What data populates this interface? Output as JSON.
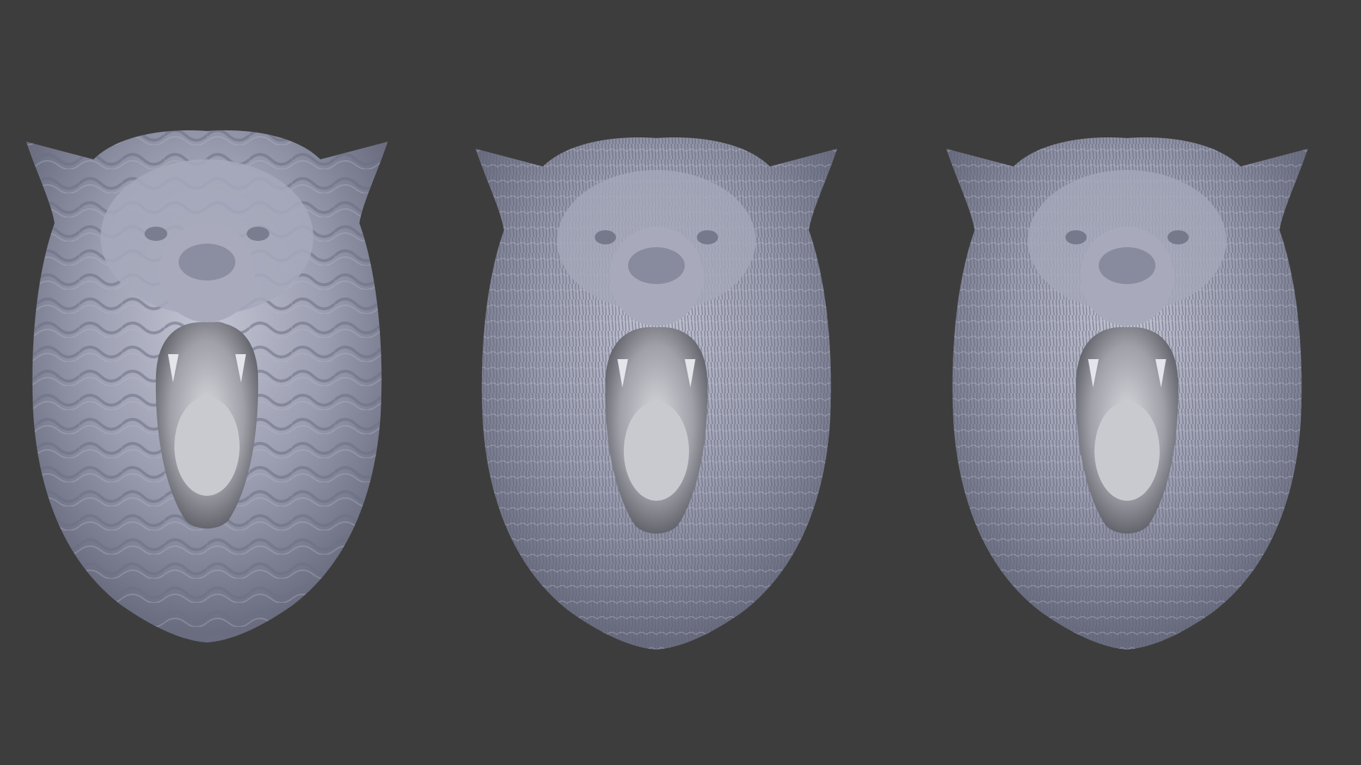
{
  "scene": {
    "background_color": "#3d3d3d",
    "material_color": "#9a9db0",
    "material_highlight": "#c9ccd8",
    "material_shadow": "#55586a",
    "mouth_color": "#b7b8bf",
    "models": [
      {
        "id": "wolf-head-left",
        "detail_level": "low"
      },
      {
        "id": "wolf-head-middle",
        "detail_level": "high"
      },
      {
        "id": "wolf-head-right",
        "detail_level": "high"
      }
    ]
  }
}
